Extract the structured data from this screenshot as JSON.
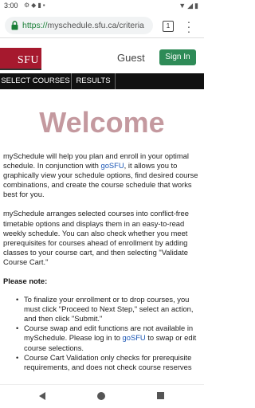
{
  "status_bar": {
    "time": "3:00",
    "left_icons": [
      "gear-icon",
      "shield-icon",
      "sim-icon",
      "lock-icon"
    ],
    "right_icons": [
      "wifi-icon",
      "signal-icon",
      "battery-icon"
    ]
  },
  "address_bar": {
    "scheme": "https://",
    "url_rest": "myschedule.sfu.ca/criteria",
    "tab_count": "1"
  },
  "header": {
    "logo_text": "SFU",
    "guest_label": "Guest",
    "sign_in_label": "Sign In",
    "brand_color": "#a6192e",
    "button_color": "#2e8b57"
  },
  "nav": {
    "tabs": [
      {
        "label": "SELECT COURSES"
      },
      {
        "label": "RESULTS"
      }
    ]
  },
  "main": {
    "title": "Welcome",
    "p1_a": "mySchedule will help you plan and enroll in your optimal schedule. In conjunction with ",
    "p1_link": "goSFU",
    "p1_b": ", it allows you to graphically view your schedule options, find desired course combinations, and create the course schedule that works best for you.",
    "p2": "mySchedule arranges selected courses into conflict-free timetable options and displays them in an easy-to-read weekly schedule. You can also check whether you meet prerequisites for courses ahead of enrollment by adding classes to your course cart, and then selecting \"Validate Course Cart.\"",
    "note_heading": "Please note:",
    "notes": [
      "To finalize your enrollment or to drop courses, you must click \"Proceed to Next Step,\" select an action, and then click \"Submit.\"",
      "Course swap and edit functions are not available in mySchedule. Please log in to ",
      "Course Cart Validation only checks for prerequisite requirements, and does not check course reserves"
    ],
    "note2_link": "goSFU",
    "note2_tail": " to swap or edit course selections."
  }
}
